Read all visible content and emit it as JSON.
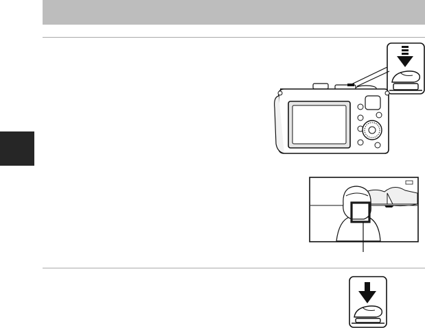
{
  "page": {
    "header": {
      "background": "#bdbdbd"
    },
    "section_tab": {
      "color": "#262626"
    },
    "step1": {
      "camera_illustration": {
        "icon": "camera-back-view-icon"
      },
      "shutter_press_icon": "shutter-half-press-icon",
      "viewfinder_illustration": {
        "icon": "lcd-face-detection-icon",
        "focus_frame_color": "#1a1a1a"
      }
    },
    "step2": {
      "shutter_press_icon": "shutter-full-press-icon"
    },
    "colors": {
      "rule": "#a8a8a8",
      "icon_stroke": "#111111"
    }
  }
}
